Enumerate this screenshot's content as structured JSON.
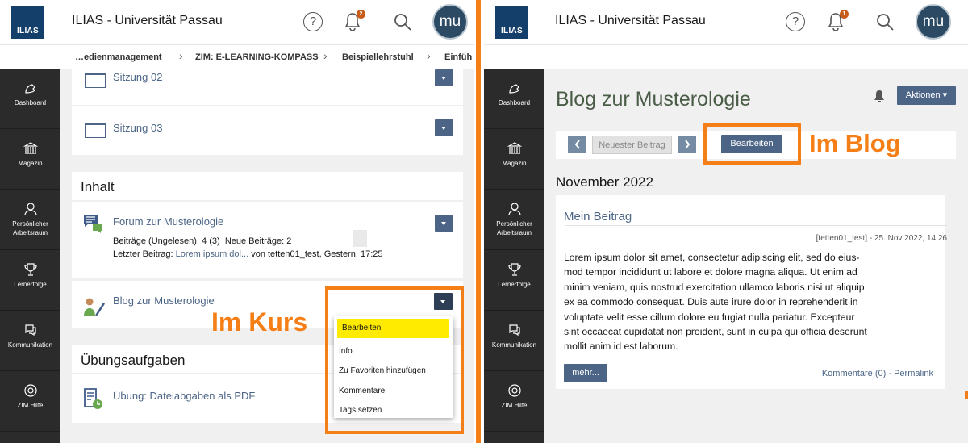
{
  "header": {
    "app_title": "ILIAS - Universität Passau",
    "logo_text": "ILIAS",
    "avatar_initials": "mu"
  },
  "left": {
    "notification_count": "2",
    "breadcrumbs": [
      "…edienmanagement",
      "ZIM: E-LEARNING-KOMPASS",
      "Beispiellehrstuhl",
      "Einfüh"
    ],
    "folders": [
      {
        "label": "Sitzung 02"
      },
      {
        "label": "Sitzung 03"
      }
    ],
    "section_content": "Inhalt",
    "forum": {
      "title": "Forum zur Musterologie",
      "posts_label": "Beiträge (Ungelesen): 4 (3)",
      "new_posts": "Neue Beiträge: 2",
      "last_post_prefix": "Letzter Beitrag:",
      "last_post_link": "Lorem ipsum dol...",
      "last_post_suffix": "von tetten01_test, Gestern, 17:25"
    },
    "blog": {
      "title": "Blog zur Musterologie"
    },
    "section_exercises": "Übungsaufgaben",
    "exercise": {
      "title": "Übung: Dateiabgaben als PDF"
    },
    "callout": "Im Kurs",
    "dropdown_items": [
      "Bearbeiten",
      "Info",
      "Zu Favoriten hinzufügen",
      "Kommentare",
      "Tags setzen"
    ]
  },
  "right": {
    "notification_count": "1",
    "page_title": "Blog zur Musterologie",
    "actions_label": "Aktionen",
    "newest_label": "Neuester Beitrag",
    "edit_label": "Bearbeiten",
    "callout": "Im Blog",
    "month": "November 2022",
    "post_title": "Mein Beitrag",
    "post_meta": "[tetten01_test] - 25. Nov 2022, 14:26",
    "post_lines": [
      "Lorem ipsum dolor sit amet, consectetur adipiscing elit, sed do eius-",
      "mod tempor incididunt ut labore et dolore magna aliqua. Ut enim ad",
      "minim veniam, quis nostrud exercitation ullamco laboris nisi ut aliquip",
      "ex ea commodo consequat. Duis aute irure dolor in reprehenderit in",
      "voluptate velit esse cillum dolore eu fugiat nulla pariatur. Excepteur",
      "sint occaecat cupidatat non proident, sunt in culpa qui officia deserunt",
      "mollit anim id est laborum."
    ],
    "more_label": "mehr...",
    "comments_label": "Kommentare (0)",
    "permalink_label": "Permalink"
  },
  "sidebar": [
    {
      "label": "Dashboard"
    },
    {
      "label": "Magazin"
    },
    {
      "label": "Persönlicher Arbeitsraum"
    },
    {
      "label": "Lernerfolge"
    },
    {
      "label": "Kommunikation"
    },
    {
      "label": "ZIM Hilfe"
    }
  ],
  "colors": {
    "accent": "#4c6586",
    "callout": "#f57f16",
    "sidebar": "#2b2b2b",
    "logo": "#153f6b",
    "highlight": "#ffeb00"
  }
}
